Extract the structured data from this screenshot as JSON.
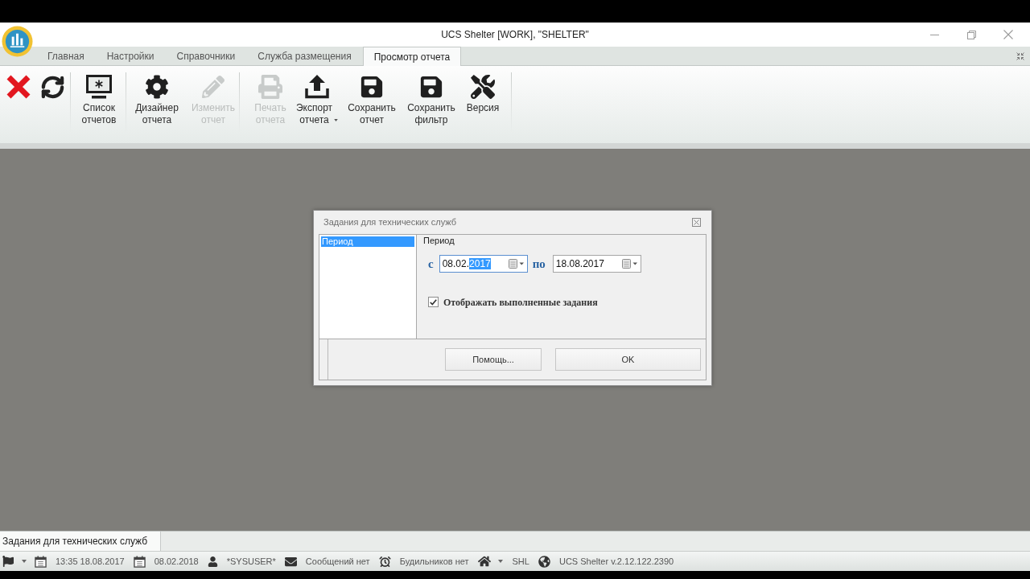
{
  "window": {
    "title": "UCS Shelter [WORK], \"SHELTER\""
  },
  "ribbon_tabs": [
    {
      "label": "Главная",
      "selected": false
    },
    {
      "label": "Настройки",
      "selected": false
    },
    {
      "label": "Справочники",
      "selected": false
    },
    {
      "label": "Служба размещения",
      "selected": false
    },
    {
      "label": "Просмотр отчета",
      "selected": true
    }
  ],
  "ribbon_buttons": [
    {
      "label": "Список отчетов",
      "disabled": false,
      "dropdown": false
    },
    {
      "label": "Дизайнер отчета",
      "disabled": false,
      "dropdown": false
    },
    {
      "label": "Изменить отчет",
      "disabled": true,
      "dropdown": false
    },
    {
      "label": "Печать отчета",
      "disabled": true,
      "dropdown": false
    },
    {
      "label": "Экспорт отчета",
      "disabled": false,
      "dropdown": true
    },
    {
      "label": "Сохранить отчет",
      "disabled": false,
      "dropdown": false
    },
    {
      "label": "Сохранить фильтр",
      "disabled": false,
      "dropdown": false
    },
    {
      "label": "Версия",
      "disabled": false,
      "dropdown": false
    }
  ],
  "dialog": {
    "title": "Задания для технических служб",
    "sections": [
      {
        "label": "Период",
        "selected": true
      }
    ],
    "panel": {
      "heading": "Период",
      "from_label": "с",
      "date_from": {
        "focused": true,
        "value_parts": [
          {
            "text": "08.02.",
            "selected": false
          },
          {
            "text": "2017",
            "selected": true
          }
        ]
      },
      "to_label": "по",
      "date_to": {
        "focused": false,
        "value_parts": [
          {
            "text": "18.08.2017",
            "selected": false
          }
        ]
      },
      "show_completed": {
        "label": "Отображать выполненные задания",
        "checked": true
      }
    },
    "buttons": [
      {
        "label": "Помощь..."
      },
      {
        "label": "OK"
      }
    ]
  },
  "document_tabs": [
    {
      "label": "Задания для технических служб",
      "selected": true
    }
  ],
  "status_bar": {
    "fields": [
      "13:35 18.08.2017",
      "08.02.2018",
      "*SYSUSER*",
      "Сообщений нет",
      "Будильников нет",
      "SHL",
      "UCS Shelter v.2.12.122.2390"
    ]
  }
}
